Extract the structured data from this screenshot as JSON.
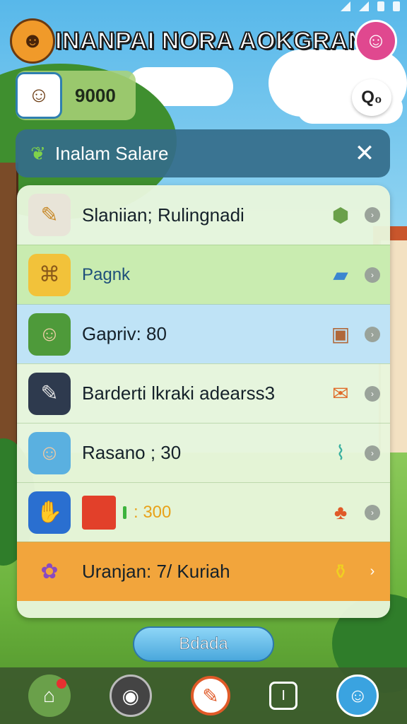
{
  "header": {
    "title": "INANPAI NORA AOKGRAN",
    "logo_icon": "☻",
    "profile_icon": "☺"
  },
  "player": {
    "avatar_icon": "☺",
    "coins": "9000",
    "chat_label": "Q₀"
  },
  "panel": {
    "title": "Inalam Salare",
    "leaf_icon": "❦",
    "close_icon": "✕"
  },
  "rows": [
    {
      "label": "Slaniian; Rulingnadi",
      "icon": "✎",
      "badge": "⬢",
      "chev": "›"
    },
    {
      "label": "Pagnk",
      "icon": "⌘",
      "badge": "▰",
      "chev": "›"
    },
    {
      "label": "Gapriv: 80",
      "icon": "☺",
      "badge": "▣",
      "chev": "›"
    },
    {
      "label": "Barderti lkraki adearss3",
      "icon": "✎",
      "badge": "✉",
      "chev": "›"
    },
    {
      "label": "Rasano ; 30",
      "icon": "☺",
      "badge": "⌇",
      "chev": "›"
    },
    {
      "label": ": 300",
      "icon": "✋",
      "badge": "♣",
      "chev": "›"
    },
    {
      "label": "Uranjan: 7/ Kuriah",
      "icon": "✿",
      "badge": "⚱",
      "chev": "›"
    }
  ],
  "action": {
    "label": "Bdada"
  },
  "nav": {
    "home_icon": "⌂",
    "settings_icon": "◉",
    "center_icon": "✎",
    "clock_icon": "I",
    "profile_icon": "☺"
  },
  "colors": {
    "accent_blue": "#4aa8dc",
    "highlight_orange": "#f2a53c",
    "panel_head": "#346c8a"
  }
}
